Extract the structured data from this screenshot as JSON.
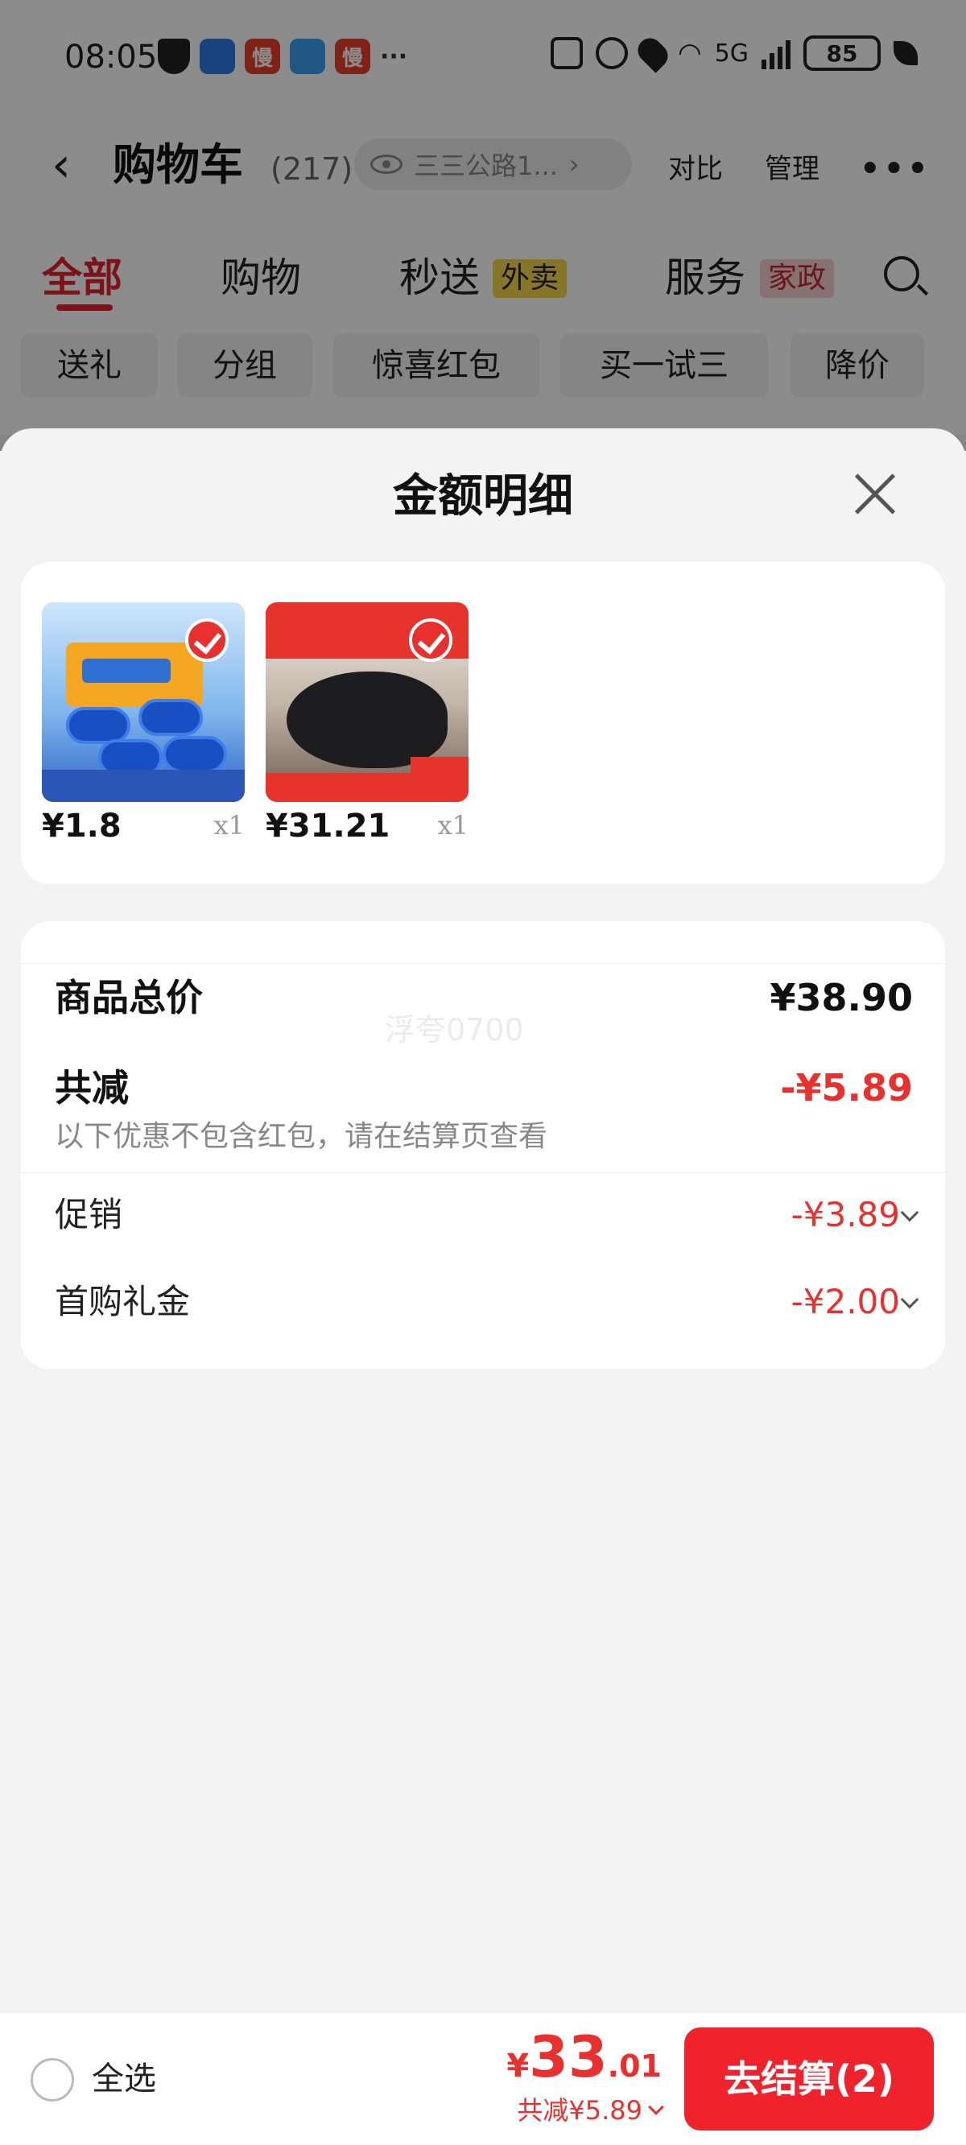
{
  "status_bar": {
    "time": "08:05",
    "app_icon_labels": [
      "",
      "慢",
      "",
      "慢"
    ],
    "overflow": "···",
    "network": "5G",
    "battery": "85"
  },
  "nav": {
    "back_icon": "chevron-left-icon",
    "title": "购物车",
    "count": "(217)",
    "address": "三三公路1...",
    "compare": "对比",
    "manage": "管理",
    "more": "•••"
  },
  "tabs": [
    {
      "label": "全部",
      "active": true
    },
    {
      "label": "购物",
      "active": false
    },
    {
      "label": "秒送",
      "badge": "外卖",
      "active": false
    },
    {
      "label": "服务",
      "badge": "家政",
      "active": false
    }
  ],
  "chips": [
    "送礼",
    "分组",
    "惊喜红包",
    "买一试三",
    "降价"
  ],
  "sheet": {
    "title": "金额明细",
    "products": [
      {
        "price": "¥1.8",
        "qty": "x1",
        "checked": true
      },
      {
        "price": "¥31.21",
        "qty": "x1",
        "checked": true
      }
    ],
    "summary": {
      "total_label": "商品总价",
      "total_value": "¥38.90",
      "watermark": "浮夸0700",
      "discount_label": "共减",
      "discount_value": "-¥5.89",
      "note": "以下优惠不包含红包，请在结算页查看",
      "items": [
        {
          "label": "促销",
          "value": "-¥3.89"
        },
        {
          "label": "首购礼金",
          "value": "-¥2.00"
        }
      ]
    }
  },
  "bottom_bar": {
    "select_all": "全选",
    "total_symbol": "¥",
    "total_int": "33",
    "total_dec": ".01",
    "discount_text": "共减¥5.89",
    "checkout_label": "去结算(2)"
  },
  "colors": {
    "accent_red": "#e8312e",
    "checkout_red": "#f0222c",
    "sheet_bg": "#f3f3f4"
  }
}
